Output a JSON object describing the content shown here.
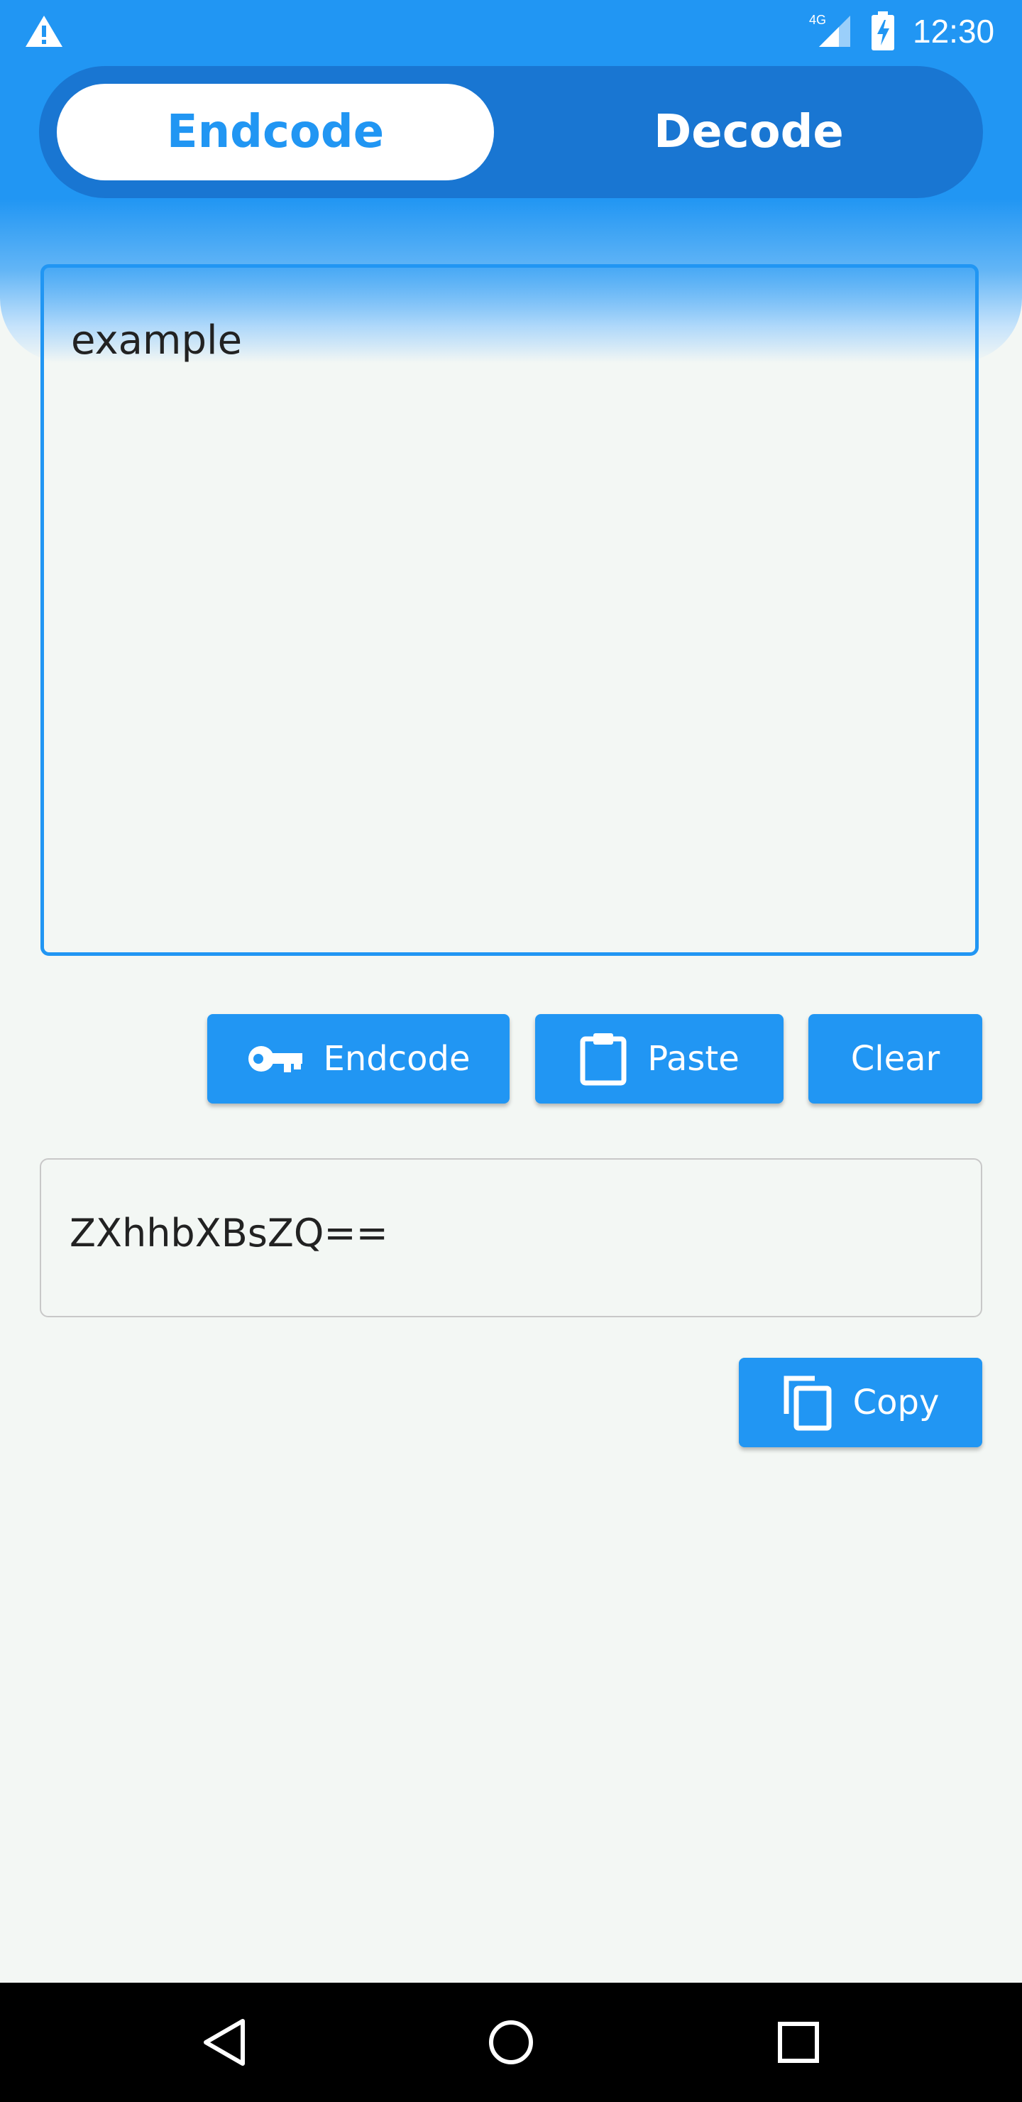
{
  "status_bar": {
    "network": "4G",
    "time": "12:30"
  },
  "mode_toggle": {
    "encode_label": "Endcode",
    "decode_label": "Decode",
    "selected": "Endcode"
  },
  "input": {
    "value": "example"
  },
  "actions": {
    "encode_label": "Endcode",
    "paste_label": "Paste",
    "clear_label": "Clear"
  },
  "output": {
    "value": "ZXhhbXBsZQ=="
  },
  "copy": {
    "label": "Copy"
  },
  "icons": {
    "warning": "warning-icon",
    "signal": "signal-icon",
    "battery": "battery-charging-icon",
    "key": "key-icon",
    "clipboard": "clipboard-icon",
    "copy": "copy-icon",
    "back": "back-icon",
    "home": "home-icon",
    "recents": "recents-icon"
  },
  "colors": {
    "primary": "#2196f3",
    "primary_dark": "#1976d2",
    "background": "#f3f7f4",
    "text": "#222222"
  }
}
